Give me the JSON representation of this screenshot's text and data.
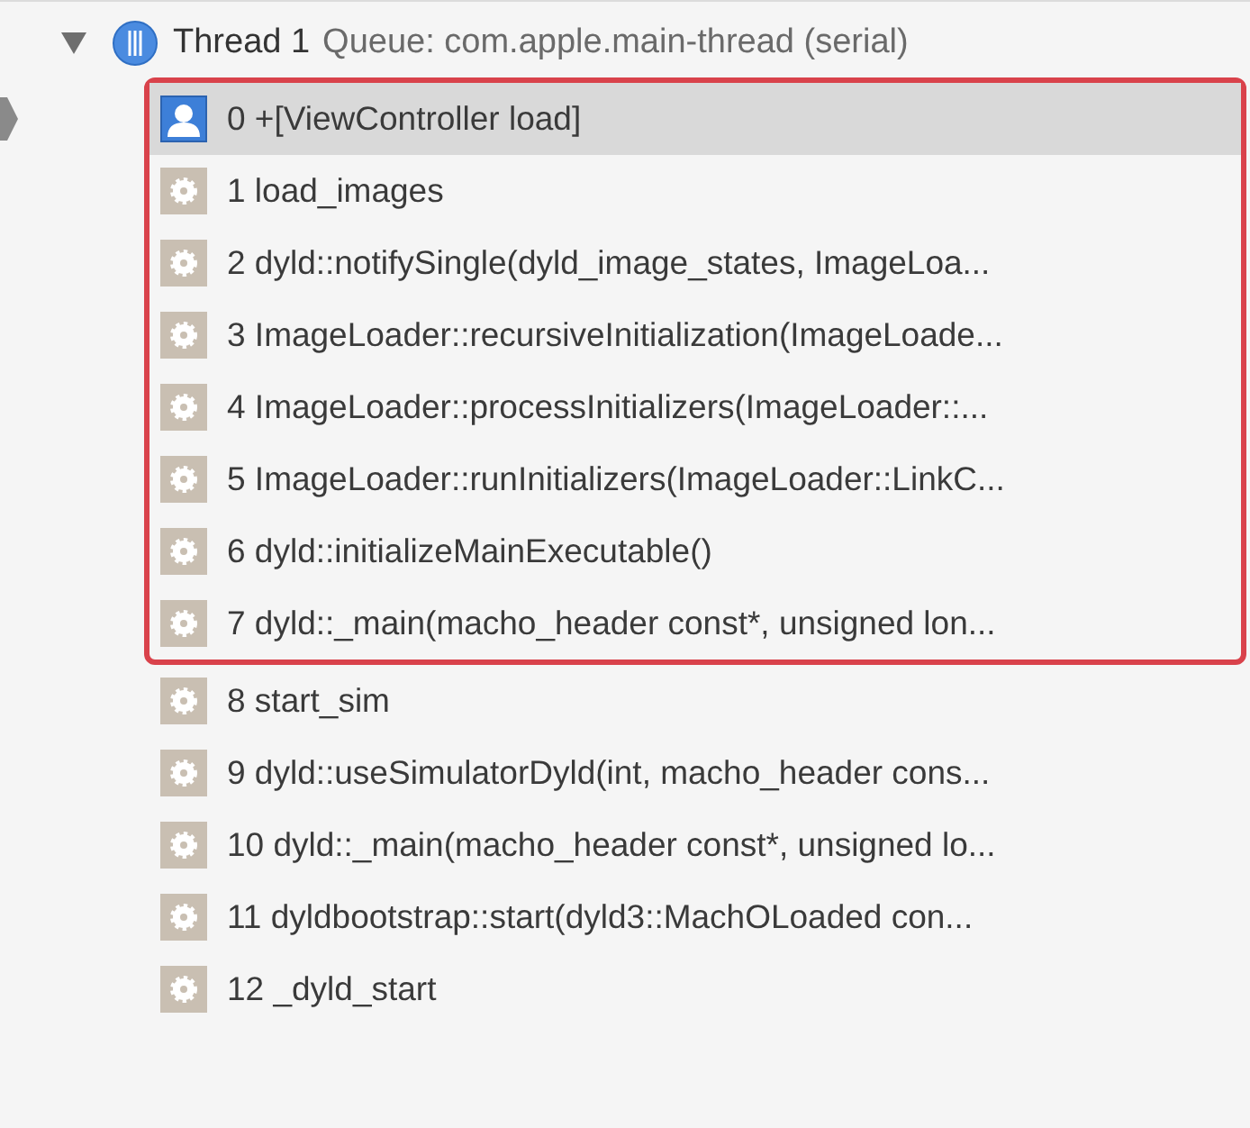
{
  "thread": {
    "expanded": true,
    "name": "Thread 1",
    "queue": "Queue: com.apple.main-thread (serial)"
  },
  "frame_groups": [
    {
      "highlighted": true,
      "frames": [
        {
          "kind": "user",
          "selected": true,
          "label": "0 +[ViewController load]"
        },
        {
          "kind": "system",
          "selected": false,
          "label": "1 load_images"
        },
        {
          "kind": "system",
          "selected": false,
          "label": "2 dyld::notifySingle(dyld_image_states, ImageLoa..."
        },
        {
          "kind": "system",
          "selected": false,
          "label": "3 ImageLoader::recursiveInitialization(ImageLoade..."
        },
        {
          "kind": "system",
          "selected": false,
          "label": "4 ImageLoader::processInitializers(ImageLoader::..."
        },
        {
          "kind": "system",
          "selected": false,
          "label": "5 ImageLoader::runInitializers(ImageLoader::LinkC..."
        },
        {
          "kind": "system",
          "selected": false,
          "label": "6 dyld::initializeMainExecutable()"
        },
        {
          "kind": "system",
          "selected": false,
          "label": "7 dyld::_main(macho_header const*, unsigned lon..."
        }
      ]
    },
    {
      "highlighted": false,
      "frames": [
        {
          "kind": "system",
          "selected": false,
          "label": "8 start_sim"
        },
        {
          "kind": "system",
          "selected": false,
          "label": "9 dyld::useSimulatorDyld(int, macho_header cons..."
        },
        {
          "kind": "system",
          "selected": false,
          "label": "10 dyld::_main(macho_header const*, unsigned lo..."
        },
        {
          "kind": "system",
          "selected": false,
          "label": "11 dyldbootstrap::start(dyld3::MachOLoaded con..."
        },
        {
          "kind": "system",
          "selected": false,
          "label": "12 _dyld_start"
        }
      ]
    }
  ]
}
